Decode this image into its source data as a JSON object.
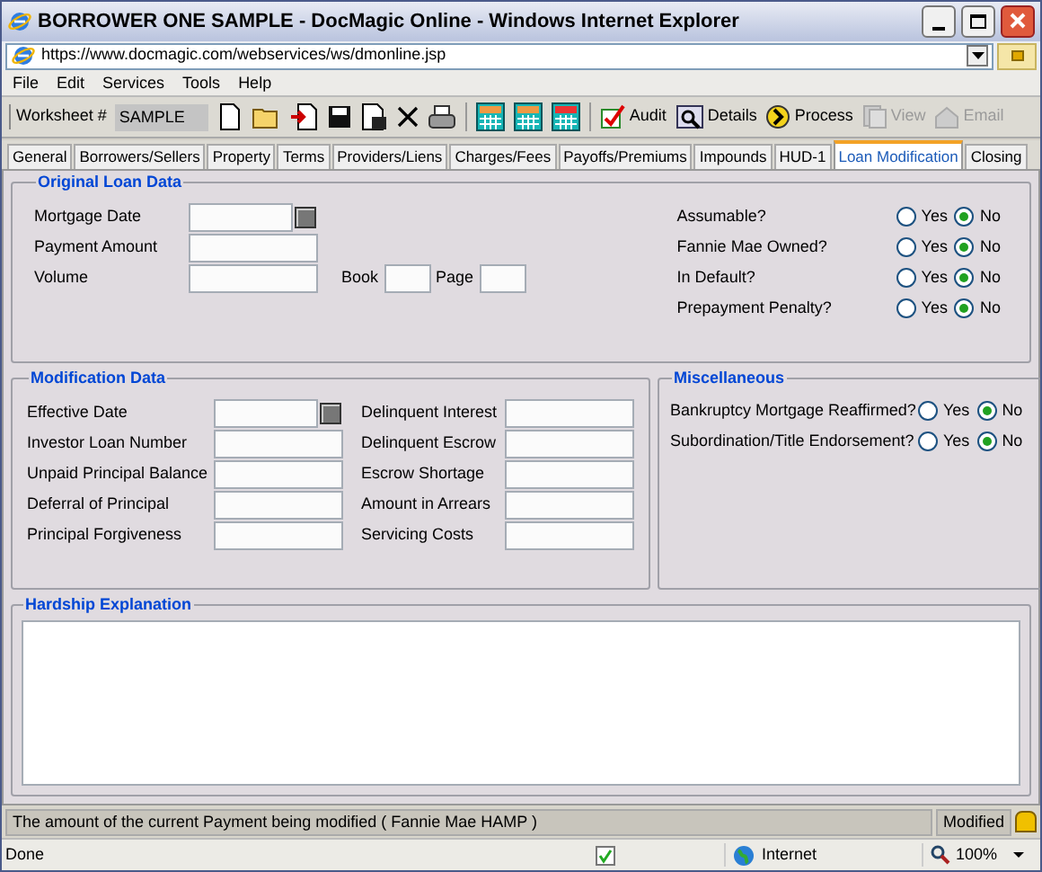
{
  "window": {
    "title": "BORROWER ONE SAMPLE - DocMagic Online - Windows Internet Explorer"
  },
  "address_bar": {
    "url": "https://www.docmagic.com/webservices/ws/dmonline.jsp"
  },
  "menu": [
    "File",
    "Edit",
    "Services",
    "Tools",
    "Help"
  ],
  "toolbar": {
    "worksheet_label": "Worksheet #",
    "worksheet_value": "SAMPLE",
    "actions": [
      {
        "label": "Audit",
        "disabled": false
      },
      {
        "label": "Details",
        "disabled": false
      },
      {
        "label": "Process",
        "disabled": false
      },
      {
        "label": "View",
        "disabled": true
      },
      {
        "label": "Email",
        "disabled": true
      }
    ]
  },
  "tabs": [
    {
      "label": "General",
      "selected": false
    },
    {
      "label": "Borrowers/Sellers",
      "selected": false
    },
    {
      "label": "Property",
      "selected": false
    },
    {
      "label": "Terms",
      "selected": false
    },
    {
      "label": "Providers/Liens",
      "selected": false
    },
    {
      "label": "Charges/Fees",
      "selected": false
    },
    {
      "label": "Payoffs/Premiums",
      "selected": false
    },
    {
      "label": "Impounds",
      "selected": false
    },
    {
      "label": "HUD-1",
      "selected": false
    },
    {
      "label": "Loan Modification",
      "selected": true
    },
    {
      "label": "Closing",
      "selected": false
    }
  ],
  "original_loan_data": {
    "title": "Original Loan Data",
    "fields": [
      {
        "label": "Mortgage Date",
        "kind": "date"
      },
      {
        "label": "Payment Amount",
        "kind": "text"
      },
      {
        "label": "Volume",
        "kind": "text"
      }
    ],
    "book": {
      "label": "Book"
    },
    "page": {
      "label": "Page"
    },
    "questions": [
      {
        "label": "Assumable?",
        "options": [
          {
            "label": "Yes",
            "selected": false
          },
          {
            "label": "No",
            "selected": true
          }
        ]
      },
      {
        "label": "Fannie Mae Owned?",
        "options": [
          {
            "label": "Yes",
            "selected": false
          },
          {
            "label": "No",
            "selected": true
          }
        ]
      },
      {
        "label": "In Default?",
        "options": [
          {
            "label": "Yes",
            "selected": false
          },
          {
            "label": "No",
            "selected": true
          }
        ]
      },
      {
        "label": "Prepayment Penalty?",
        "options": [
          {
            "label": "Yes",
            "selected": false
          },
          {
            "label": "No",
            "selected": true
          }
        ]
      }
    ]
  },
  "modification_data": {
    "title": "Modification Data",
    "left_fields": [
      {
        "label": "Effective Date",
        "kind": "date"
      },
      {
        "label": "Investor Loan Number",
        "kind": "text"
      },
      {
        "label": "Unpaid Principal Balance",
        "kind": "text"
      },
      {
        "label": "Deferral of Principal",
        "kind": "text"
      },
      {
        "label": "Principal Forgiveness",
        "kind": "text"
      }
    ],
    "right_fields": [
      {
        "label": "Delinquent Interest",
        "kind": "text"
      },
      {
        "label": "Delinquent Escrow",
        "kind": "text"
      },
      {
        "label": "Escrow Shortage",
        "kind": "text"
      },
      {
        "label": "Amount in Arrears",
        "kind": "text"
      },
      {
        "label": "Servicing Costs",
        "kind": "text"
      }
    ]
  },
  "miscellaneous": {
    "title": "Miscellaneous",
    "questions": [
      {
        "label": "Bankruptcy Mortgage Reaffirmed?",
        "options": [
          {
            "label": "Yes",
            "selected": false
          },
          {
            "label": "No",
            "selected": true
          }
        ]
      },
      {
        "label": "Subordination/Title Endorsement?",
        "options": [
          {
            "label": "Yes",
            "selected": false
          },
          {
            "label": "No",
            "selected": true
          }
        ]
      }
    ]
  },
  "hardship_explanation": {
    "title": "Hardship Explanation"
  },
  "status_bar": {
    "message": "The amount of the current Payment being modified ( Fannie Mae HAMP )",
    "state": "Modified"
  },
  "browser_status": {
    "text": "Done",
    "zone": "Internet",
    "zoom": "100%"
  }
}
